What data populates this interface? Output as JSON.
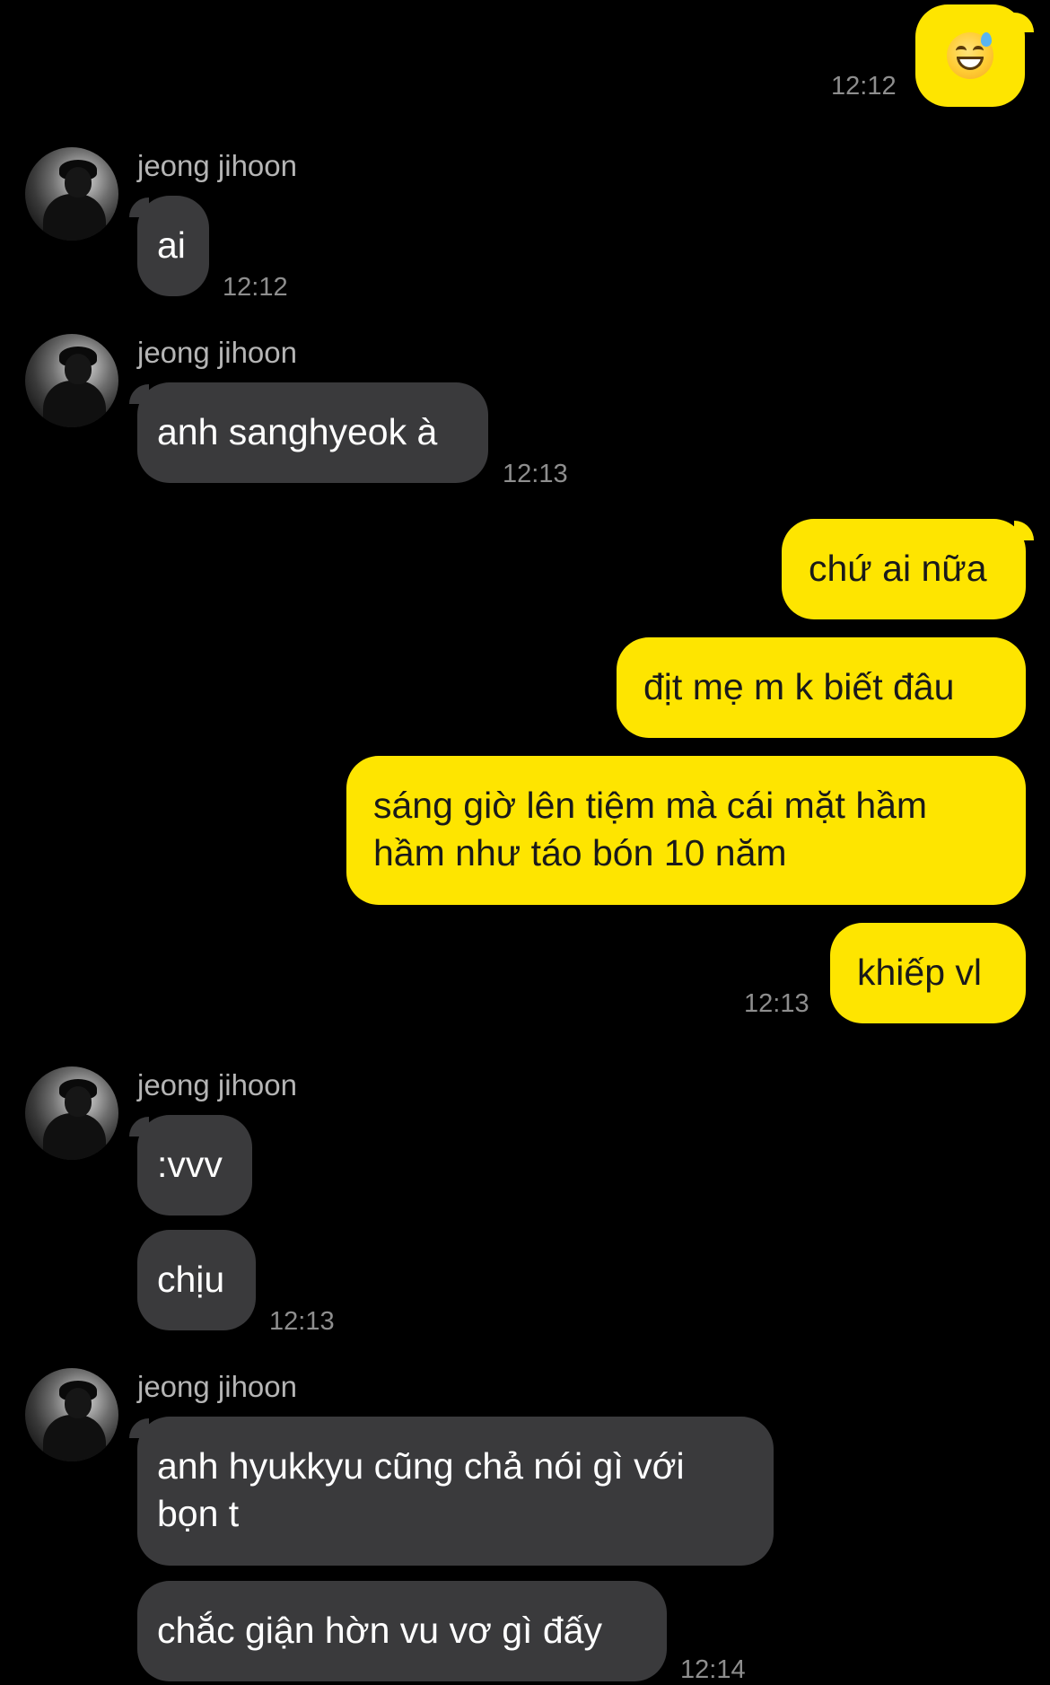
{
  "contact": {
    "name": "jeong jihoon",
    "avatar_icon": "profile-photo-avatar"
  },
  "colors": {
    "background": "#000000",
    "outgoing_bubble": "#fee500",
    "incoming_bubble": "#3a3a3c",
    "timestamp": "#8e8e8e",
    "sender_name": "#b5b5b5"
  },
  "messages": {
    "m1": {
      "direction": "outgoing",
      "text": "",
      "emoji": "grinning-face-with-sweat-icon",
      "time": "12:12"
    },
    "g1": {
      "sender": "jeong jihoon",
      "items": [
        {
          "text": "ai"
        }
      ],
      "time": "12:12"
    },
    "g2": {
      "sender": "jeong jihoon",
      "items": [
        {
          "text": "anh sanghyeok à"
        }
      ],
      "time": "12:13"
    },
    "g3": {
      "direction": "outgoing",
      "items": [
        {
          "text": "chứ ai nữa"
        },
        {
          "text": "địt mẹ m k biết đâu"
        },
        {
          "text": "sáng giờ lên tiệm mà cái mặt hầm\nhầm như táo bón 10 năm"
        },
        {
          "text": "khiếp vl"
        }
      ],
      "time": "12:13"
    },
    "g4": {
      "sender": "jeong jihoon",
      "items": [
        {
          "text": ":vvv"
        },
        {
          "text": "chịu"
        }
      ],
      "time": "12:13"
    },
    "g5": {
      "sender": "jeong jihoon",
      "items": [
        {
          "text": "anh hyukkyu cũng chả nói gì với\nbọn t"
        },
        {
          "text": "chắc giận hờn vu vơ gì đấy"
        }
      ],
      "time": "12:14"
    }
  }
}
